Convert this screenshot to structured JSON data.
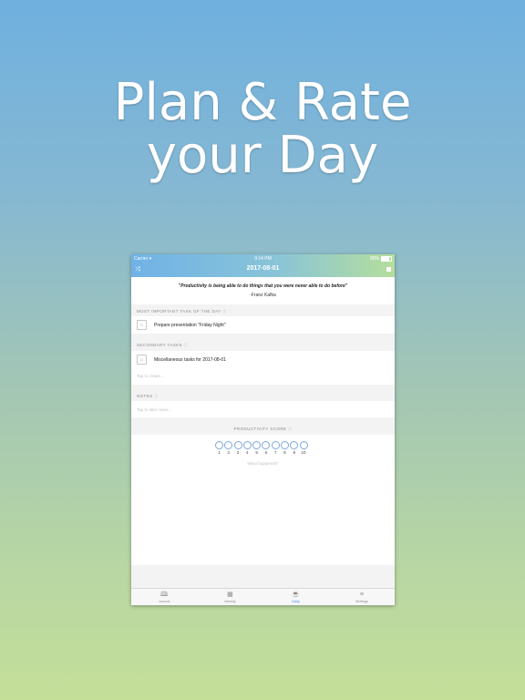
{
  "headline": {
    "line1": "Plan & Rate",
    "line2": "your Day"
  },
  "status": {
    "carrier": "Carrier",
    "time": "9:14 PM",
    "battery": "80%"
  },
  "nav": {
    "title": "2017-08-01"
  },
  "quote": {
    "text": "\"Productivity is being able to do things that you were never able to do before\"",
    "author": "-Franz Kafka"
  },
  "mit": {
    "label": "MOST IMPORTANT TASK OF THE DAY",
    "task": {
      "check": "0",
      "text": "Prepare presentation \"Friday Night\""
    }
  },
  "secondary": {
    "label": "SECONDARY TASKS",
    "task": {
      "check": "0",
      "text": "Miscellaneous tasks for 2017-08-01"
    },
    "placeholder": "Tap to create..."
  },
  "notes": {
    "label": "NOTES",
    "placeholder": "Tap to take notes..."
  },
  "score": {
    "label": "PRODUCTIVITY SCORE",
    "values": [
      "1",
      "2",
      "3",
      "4",
      "5",
      "6",
      "7",
      "8",
      "9",
      "10"
    ],
    "placeholder": "What happened?"
  },
  "tabs": [
    {
      "label": "Journal",
      "icon": "book-icon"
    },
    {
      "label": "Weekly",
      "icon": "calendar-grid-icon"
    },
    {
      "label": "Daily",
      "icon": "coffee-cup-icon",
      "active": true
    },
    {
      "label": "Settings",
      "icon": "menu-lines-icon"
    }
  ],
  "colors": {
    "accent": "#4a90e2",
    "bar_start": "#70b2e6",
    "bar_end": "#b5de9c"
  }
}
